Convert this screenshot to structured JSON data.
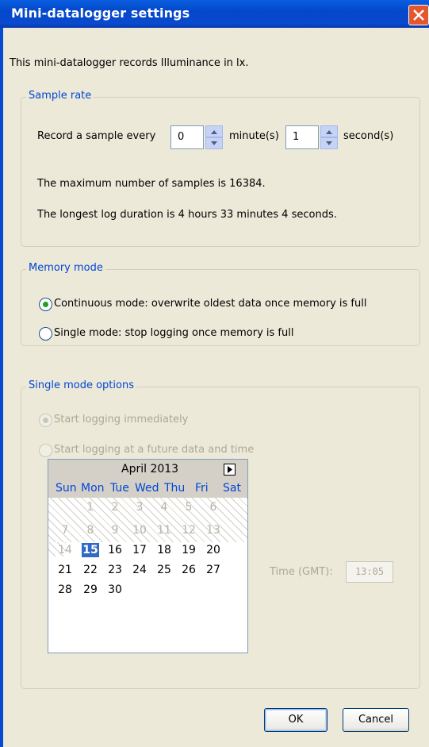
{
  "window": {
    "title": "Mini-datalogger settings"
  },
  "description": "This mini-datalogger records Illuminance in lx.",
  "sample_rate": {
    "legend": "Sample rate",
    "record_label": "Record a sample every",
    "minutes_value": "0",
    "minutes_unit": "minute(s)",
    "seconds_value": "1",
    "seconds_unit": "second(s)",
    "max_samples_text": "The maximum number of samples is 16384.",
    "duration_text": "The longest log duration is 4 hours 33 minutes 4 seconds."
  },
  "memory_mode": {
    "legend": "Memory mode",
    "continuous_label": "Continuous mode: overwrite oldest data once memory is full",
    "single_label": "Single mode: stop logging once memory is full",
    "selected": "continuous"
  },
  "single_mode_options": {
    "legend": "Single mode options",
    "immediately_label": "Start logging immediately",
    "future_label": "Start logging at a future data and time",
    "selected": "immediately",
    "enabled": false
  },
  "calendar": {
    "month_label": "April 2013",
    "weekdays": [
      "Sun",
      "Mon",
      "Tue",
      "Wed",
      "Thu",
      "Fri",
      "Sat"
    ],
    "weeks": [
      [
        "",
        "1",
        "2",
        "3",
        "4",
        "5",
        "6"
      ],
      [
        "7",
        "8",
        "9",
        "10",
        "11",
        "12",
        "13"
      ],
      [
        "14",
        "15",
        "16",
        "17",
        "18",
        "19",
        "20"
      ],
      [
        "21",
        "22",
        "23",
        "24",
        "25",
        "26",
        "27"
      ],
      [
        "28",
        "29",
        "30",
        "",
        "",
        "",
        ""
      ]
    ],
    "selected_day": "15"
  },
  "time": {
    "label": "Time (GMT):",
    "value": "13:05"
  },
  "buttons": {
    "ok": "OK",
    "cancel": "Cancel"
  },
  "colors": {
    "title_bar": "#0a4ad0",
    "legend_text": "#0046d5",
    "accent": "#316ac5",
    "close_button": "#e4572e"
  }
}
